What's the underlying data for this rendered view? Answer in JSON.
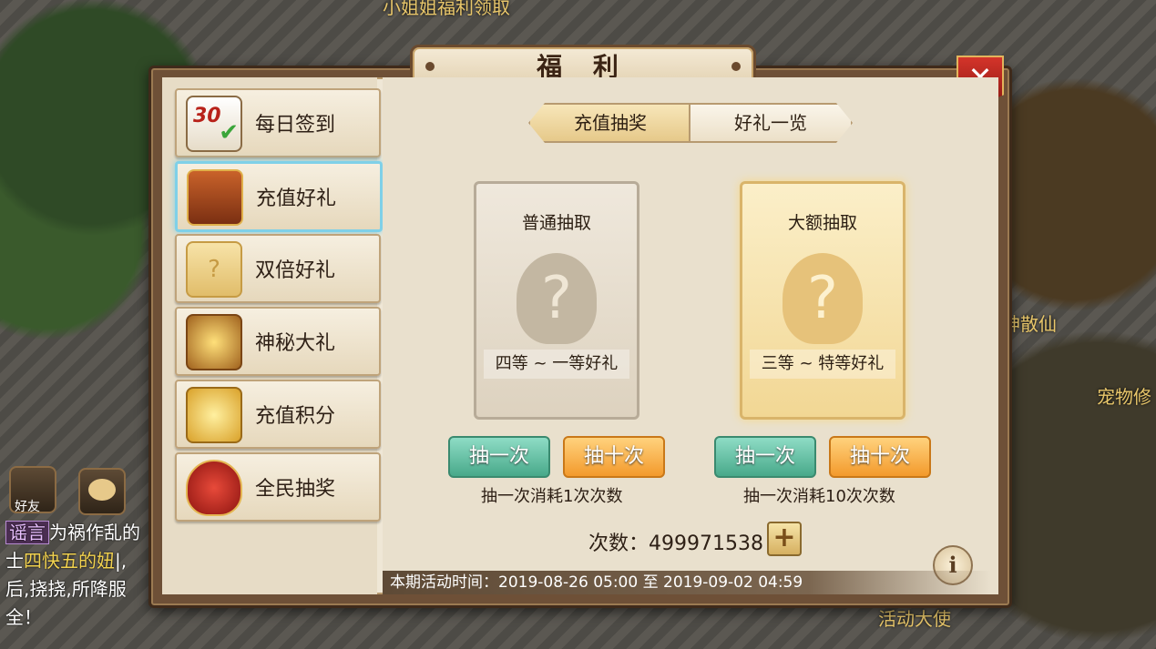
{
  "scene": {
    "top_banner": "小姐姐福利领取",
    "npc_right_1": "神散仙",
    "npc_right_2": "宠物修",
    "npc_bottom": "活动大使",
    "friends_label": "好友"
  },
  "chat": {
    "tag": "谣言",
    "line1": "为祸作乱的",
    "line2_prefix": "士",
    "line2_name": "四快五的妞",
    "line2_suffix": "|,",
    "line3": "后,挠挠,所降服",
    "line4": "全！"
  },
  "window": {
    "title": "福 利",
    "close_icon": "close-x-icon"
  },
  "sidebar": {
    "items": [
      {
        "label": "每日签到",
        "icon": "calendar-icon"
      },
      {
        "label": "充值好礼",
        "icon": "treasure-chest-icon"
      },
      {
        "label": "双倍好礼",
        "icon": "mystery-cards-icon"
      },
      {
        "label": "神秘大礼",
        "icon": "gold-chest-icon"
      },
      {
        "label": "充值积分",
        "icon": "gold-ingots-icon"
      },
      {
        "label": "全民抽奖",
        "icon": "lucky-bag-icon"
      }
    ],
    "calendar_number": "30"
  },
  "tabs": [
    {
      "label": "充值抽奖",
      "active": true
    },
    {
      "label": "好礼一览",
      "active": false
    }
  ],
  "cards": {
    "normal": {
      "title": "普通抽取",
      "subtitle": "四等 ~ 一等好礼",
      "symbol": "?"
    },
    "big": {
      "title": "大额抽取",
      "subtitle": "三等 ~ 特等好礼",
      "symbol": "?"
    }
  },
  "buttons": {
    "draw_once": "抽一次",
    "draw_ten": "抽十次"
  },
  "notes": {
    "normal": "抽一次消耗1次次数",
    "big": "抽一次消耗10次次数"
  },
  "count": {
    "label": "次数：499971538",
    "plus": "+"
  },
  "info_symbol": "i",
  "period": "本期活动时间：2019-08-26 05:00 至 2019-09-02 04:59"
}
